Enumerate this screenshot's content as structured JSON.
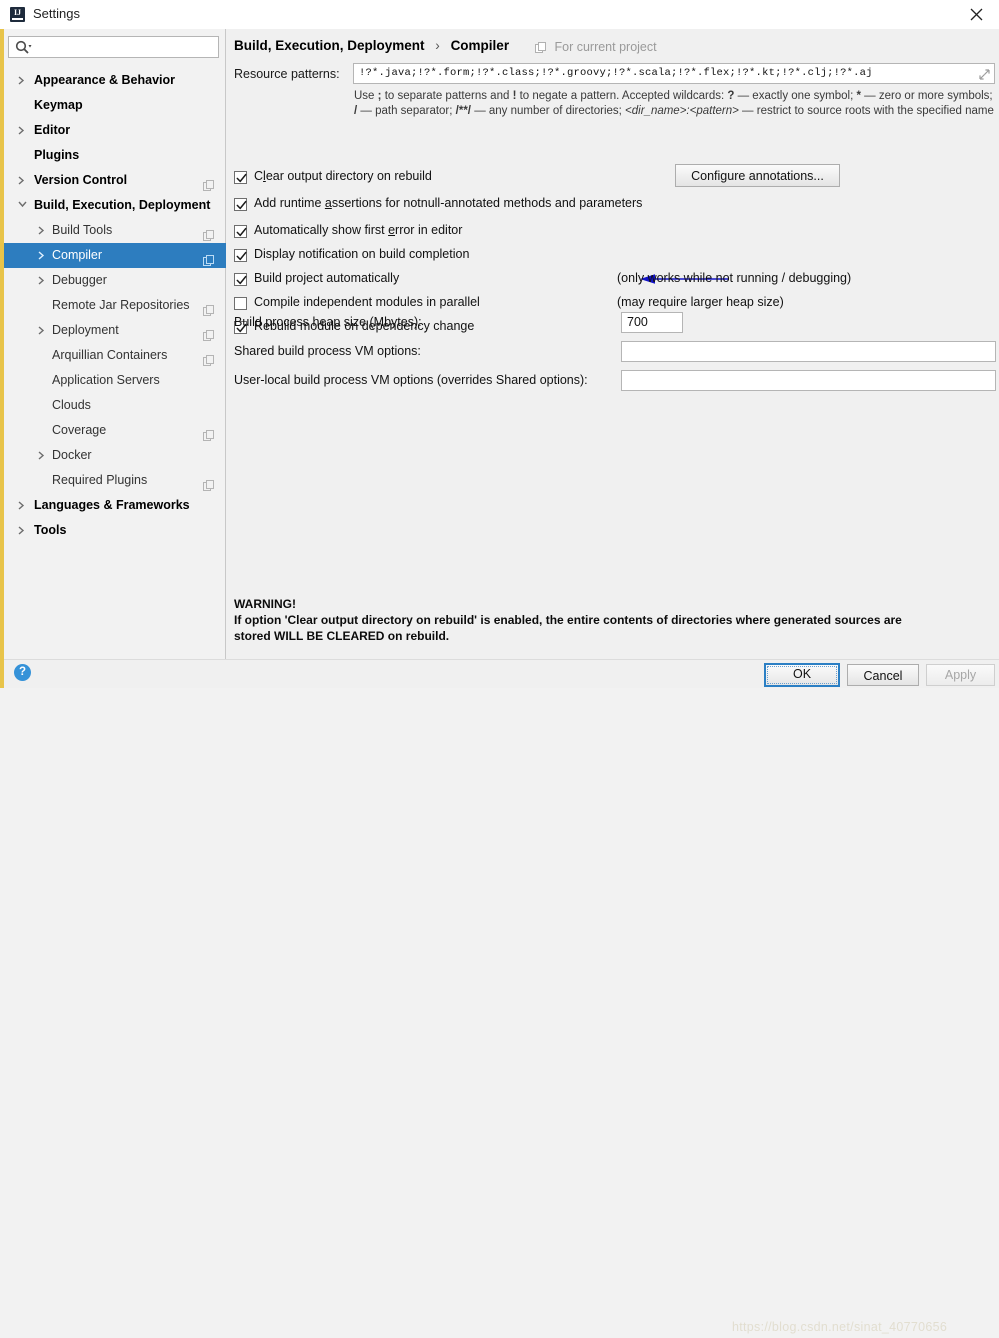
{
  "window": {
    "title": "Settings",
    "app_icon": "intellij-idea-icon",
    "close_icon": "close-icon"
  },
  "sidebar": {
    "search": {
      "placeholder": "",
      "value": "",
      "icon": "search-icon"
    },
    "items": [
      {
        "label": "Appearance & Behavior",
        "level": 0,
        "expandable": true,
        "expanded": false,
        "selected": false,
        "config_icon": false
      },
      {
        "label": "Keymap",
        "level": 0,
        "expandable": false,
        "expanded": false,
        "selected": false,
        "config_icon": false
      },
      {
        "label": "Editor",
        "level": 0,
        "expandable": true,
        "expanded": false,
        "selected": false,
        "config_icon": false
      },
      {
        "label": "Plugins",
        "level": 0,
        "expandable": false,
        "expanded": false,
        "selected": false,
        "config_icon": false
      },
      {
        "label": "Version Control",
        "level": 0,
        "expandable": true,
        "expanded": false,
        "selected": false,
        "config_icon": true
      },
      {
        "label": "Build, Execution, Deployment",
        "level": 0,
        "expandable": true,
        "expanded": true,
        "selected": false,
        "config_icon": false
      },
      {
        "label": "Build Tools",
        "level": 1,
        "expandable": true,
        "expanded": false,
        "selected": false,
        "config_icon": true
      },
      {
        "label": "Compiler",
        "level": 1,
        "expandable": true,
        "expanded": false,
        "selected": true,
        "config_icon": true
      },
      {
        "label": "Debugger",
        "level": 1,
        "expandable": true,
        "expanded": false,
        "selected": false,
        "config_icon": false
      },
      {
        "label": "Remote Jar Repositories",
        "level": 1,
        "expandable": false,
        "expanded": false,
        "selected": false,
        "config_icon": true
      },
      {
        "label": "Deployment",
        "level": 1,
        "expandable": true,
        "expanded": false,
        "selected": false,
        "config_icon": true
      },
      {
        "label": "Arquillian Containers",
        "level": 1,
        "expandable": false,
        "expanded": false,
        "selected": false,
        "config_icon": true
      },
      {
        "label": "Application Servers",
        "level": 1,
        "expandable": false,
        "expanded": false,
        "selected": false,
        "config_icon": false
      },
      {
        "label": "Clouds",
        "level": 1,
        "expandable": false,
        "expanded": false,
        "selected": false,
        "config_icon": false
      },
      {
        "label": "Coverage",
        "level": 1,
        "expandable": false,
        "expanded": false,
        "selected": false,
        "config_icon": true
      },
      {
        "label": "Docker",
        "level": 1,
        "expandable": true,
        "expanded": false,
        "selected": false,
        "config_icon": false
      },
      {
        "label": "Required Plugins",
        "level": 1,
        "expandable": false,
        "expanded": false,
        "selected": false,
        "config_icon": true
      },
      {
        "label": "Languages & Frameworks",
        "level": 0,
        "expandable": true,
        "expanded": false,
        "selected": false,
        "config_icon": false
      },
      {
        "label": "Tools",
        "level": 0,
        "expandable": true,
        "expanded": false,
        "selected": false,
        "config_icon": false
      }
    ]
  },
  "content": {
    "breadcrumb": {
      "parent": "Build, Execution, Deployment",
      "separator": "›",
      "current": "Compiler"
    },
    "scope_note": {
      "text": "For current project",
      "icon": "project-scope-icon"
    },
    "resource_patterns": {
      "label": "Resource patterns:",
      "value": "!?*.java;!?*.form;!?*.class;!?*.groovy;!?*.scala;!?*.flex;!?*.kt;!?*.clj;!?*.aj",
      "expand_icon": "expand-editor-icon",
      "help_parts": [
        {
          "text": "Use ",
          "style": "normal"
        },
        {
          "text": ";",
          "style": "bold"
        },
        {
          "text": " to separate patterns and ",
          "style": "normal"
        },
        {
          "text": "!",
          "style": "bold"
        },
        {
          "text": " to negate a pattern. Accepted wildcards: ",
          "style": "normal"
        },
        {
          "text": "?",
          "style": "bold"
        },
        {
          "text": " — exactly one symbol; ",
          "style": "normal"
        },
        {
          "text": "*",
          "style": "bold"
        },
        {
          "text": " — zero or more symbols; ",
          "style": "normal"
        },
        {
          "text": "/",
          "style": "bold"
        },
        {
          "text": " — path separator; ",
          "style": "normal"
        },
        {
          "text": "/**/",
          "style": "bold"
        },
        {
          "text": " — any number of directories; ",
          "style": "normal"
        },
        {
          "text": "<dir_name>:<pattern>",
          "style": "italic"
        },
        {
          "text": " — restrict to source roots with the specified name",
          "style": "normal"
        }
      ]
    },
    "checkboxes": [
      {
        "label": "Clear output directory on rebuild",
        "mnemonic": "l",
        "checked": true
      },
      {
        "label": "Add runtime assertions for notnull-annotated methods and parameters",
        "mnemonic": "a",
        "checked": true
      },
      {
        "label": "Automatically show first error in editor",
        "mnemonic": "e",
        "checked": true
      },
      {
        "label": "Display notification on build completion",
        "mnemonic": "",
        "checked": true
      },
      {
        "label": "Build project automatically",
        "mnemonic": "",
        "checked": true
      },
      {
        "label": "Compile independent modules in parallel",
        "mnemonic": "",
        "checked": false
      },
      {
        "label": "Rebuild module on dependency change",
        "mnemonic": "",
        "checked": true
      }
    ],
    "configure_annotations_button": "Configure annotations...",
    "hints": [
      "(only works while not running / debugging)",
      "(may require larger heap size)"
    ],
    "fields": [
      {
        "label": "Build process heap size (Mbytes):",
        "value": "700"
      },
      {
        "label": "Shared build process VM options:",
        "value": ""
      },
      {
        "label": "User-local build process VM options (overrides Shared options):",
        "value": ""
      }
    ],
    "warning": {
      "heading": "WARNING!",
      "line1": "If option 'Clear output directory on rebuild' is enabled, the entire contents of directories where generated sources are",
      "line2": "stored WILL BE CLEARED on rebuild."
    },
    "annotation_arrow": {
      "color": "#1414c8",
      "direction": "left"
    }
  },
  "footer": {
    "help_icon": "help-question-icon",
    "ok_label": "OK",
    "cancel_label": "Cancel",
    "apply_label": "Apply",
    "apply_enabled": false,
    "watermark": "https://blog.csdn.net/sinat_40770656"
  },
  "colors": {
    "accent_stripe": "#e8c44a",
    "selection": "#2d7dbf",
    "annotation": "#1414c8",
    "help_blue": "#3592d8"
  }
}
